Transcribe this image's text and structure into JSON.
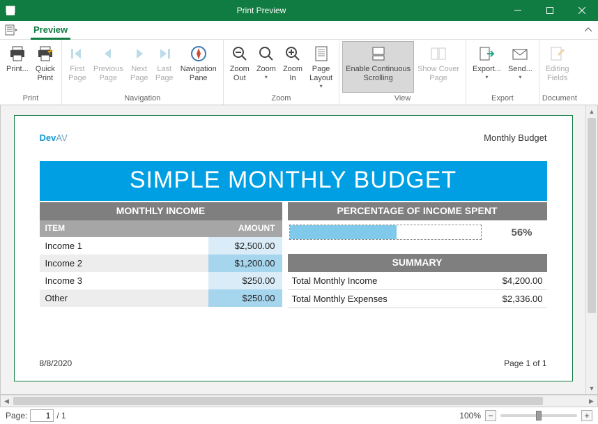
{
  "window": {
    "title": "Print Preview"
  },
  "tabs": {
    "preview": "Preview"
  },
  "ribbon": {
    "groups": {
      "print": {
        "label": "Print",
        "print": "Print...",
        "quick_print": "Quick\nPrint"
      },
      "navigation": {
        "label": "Navigation",
        "first": "First\nPage",
        "prev": "Previous\nPage",
        "next": "Next\nPage",
        "last": "Last\nPage",
        "navpane": "Navigation\nPane"
      },
      "zoom": {
        "label": "Zoom",
        "out": "Zoom\nOut",
        "zoom": "Zoom",
        "in": "Zoom\nIn",
        "layout": "Page\nLayout"
      },
      "view": {
        "label": "View",
        "cont": "Enable Continuous\nScrolling",
        "cover": "Show Cover\nPage"
      },
      "export": {
        "label": "Export",
        "export": "Export...",
        "send": "Send..."
      },
      "document": {
        "label": "Document",
        "fields": "Editing\nFields"
      }
    }
  },
  "report": {
    "brand_a": "Dev",
    "brand_b": "AV",
    "page_title": "Monthly Budget",
    "title": "SIMPLE MONTHLY BUDGET",
    "income_header": "MONTHLY INCOME",
    "item_label": "ITEM",
    "amount_label": "AMOUNT",
    "rows": [
      {
        "item": "Income 1",
        "amount": "$2,500.00"
      },
      {
        "item": "Income 2",
        "amount": "$1,200.00"
      },
      {
        "item": "Income 3",
        "amount": "$250.00"
      },
      {
        "item": "Other",
        "amount": "$250.00"
      }
    ],
    "pct_header": "PERCENTAGE OF INCOME SPENT",
    "pct_value": "56%",
    "summary_header": "SUMMARY",
    "summary_rows": [
      {
        "label": "Total Monthly Income",
        "value": "$4,200.00"
      },
      {
        "label": "Total Monthly Expenses",
        "value": "$2,336.00"
      }
    ],
    "date": "8/8/2020",
    "page_of": "Page 1 of 1"
  },
  "status": {
    "page_label": "Page:",
    "page_value": "1",
    "page_total": "/ 1",
    "zoom_value": "100%"
  }
}
